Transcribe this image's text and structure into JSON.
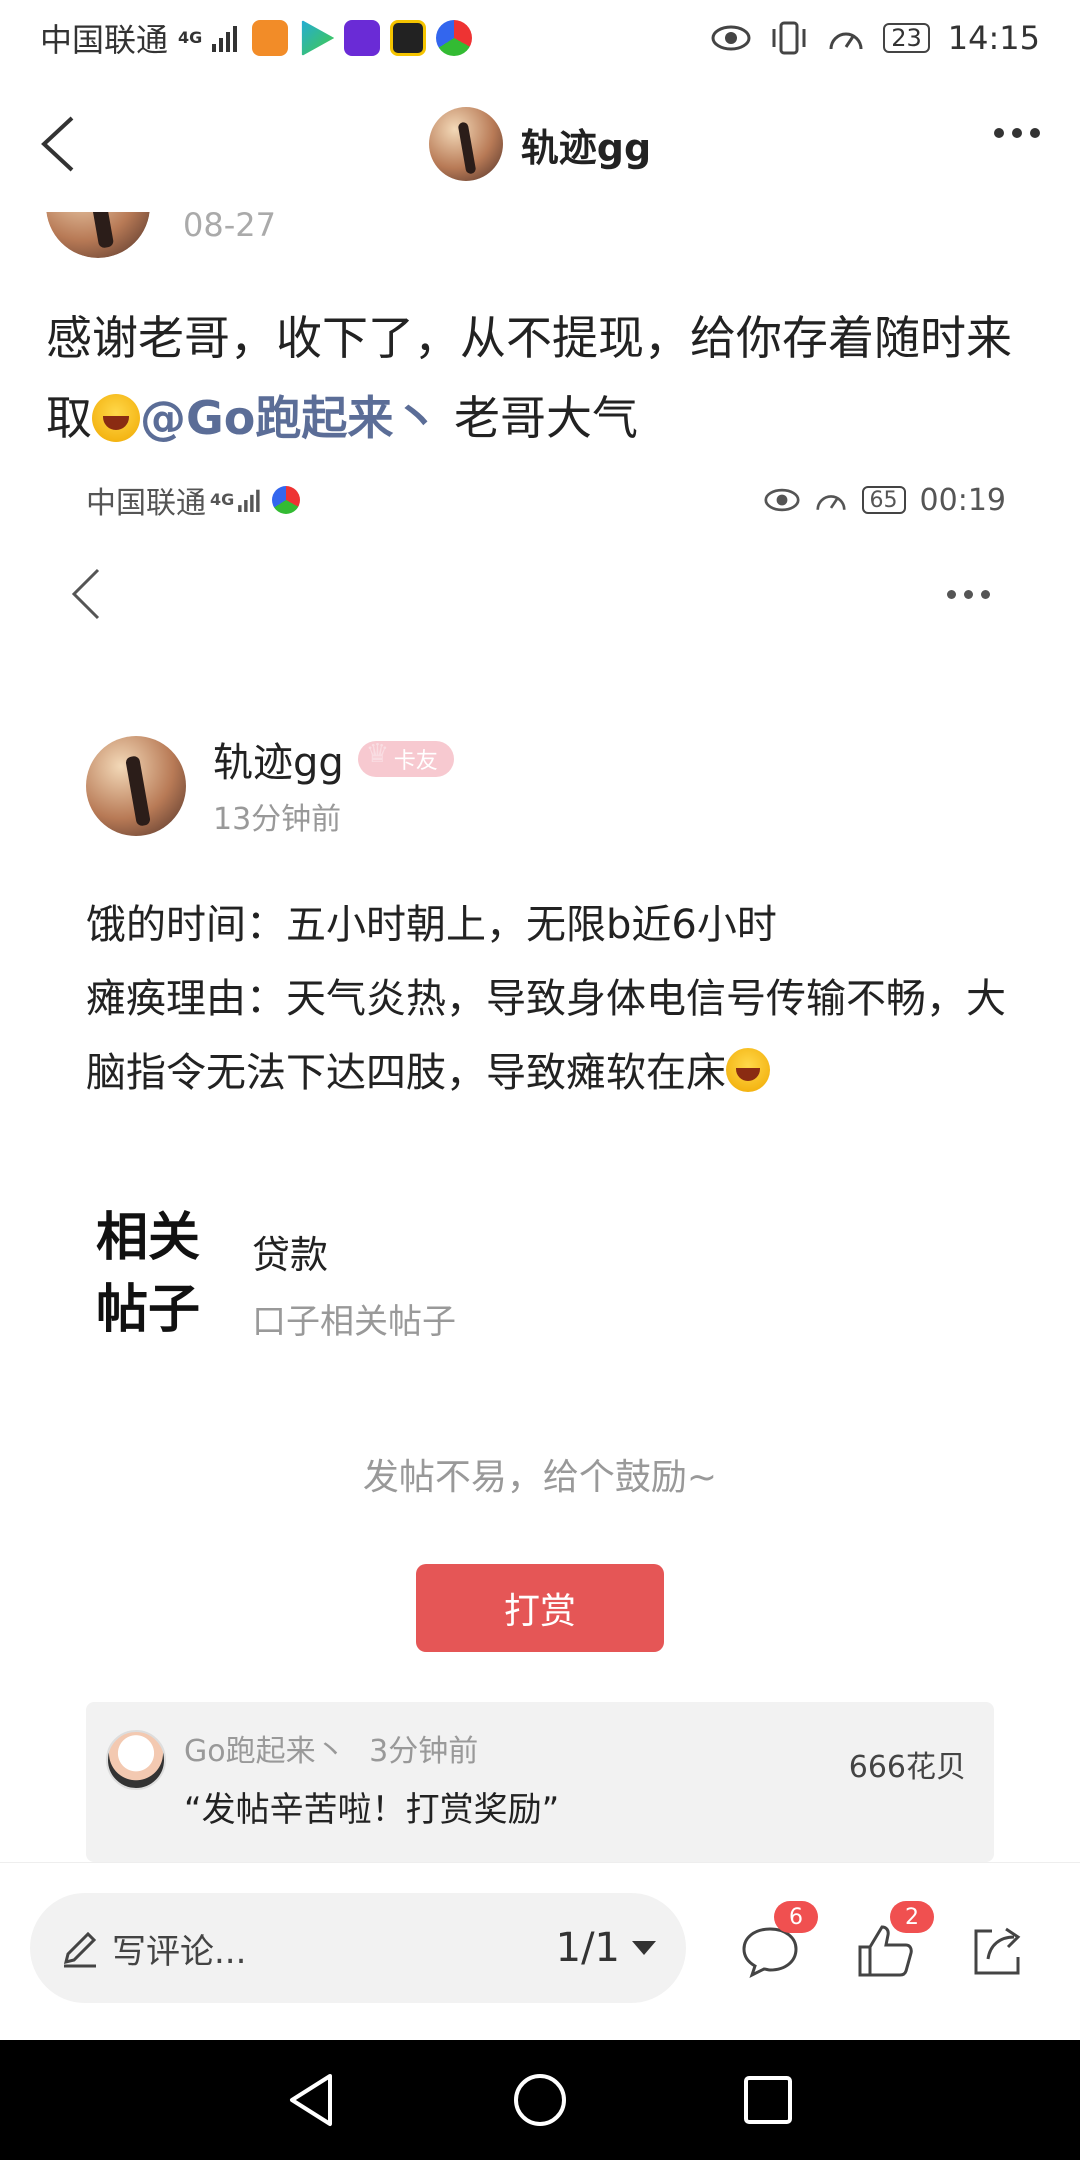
{
  "status_bar": {
    "carrier": "中国联通",
    "network": "4G",
    "battery": "23",
    "time": "14:15"
  },
  "header": {
    "title": "轨迹gg"
  },
  "partial_post": {
    "date": "08-27"
  },
  "post": {
    "text_part1": "感谢老哥，收下了，从不提现，给你存着随时来取",
    "mention": "@Go跑起来丶",
    "text_part2": "老哥大气"
  },
  "screenshot": {
    "status_bar": {
      "carrier": "中国联通",
      "network": "4G",
      "battery": "65",
      "time": "00:19"
    },
    "author": {
      "name": "轨迹gg",
      "badge": "卡友",
      "time": "13分钟前"
    },
    "body": {
      "line1": "饿的时间：五小时朝上，无限b近6小时",
      "line2": "瘫痪理由：天气炎热，导致身体电信号传输不畅，大脑指令无法下达四肢，导致瘫软在床"
    },
    "related": {
      "title": "相关帖子",
      "item1": "贷款",
      "item2": "口子相关帖子"
    },
    "encourage": "发帖不易，给个鼓励~",
    "tip_button": "打赏",
    "tip_record": {
      "user": "Go跑起来丶",
      "time": "3分钟前",
      "message": "“发帖辛苦啦！打赏奖励”",
      "amount": "666花贝"
    }
  },
  "bottom_bar": {
    "comment_placeholder": "写评论...",
    "pager": "1/1",
    "comment_count": "6",
    "like_count": "2"
  },
  "colors": {
    "mention": "#5b6d97",
    "tip_button": "#e55656",
    "badge_count": "#f05050"
  }
}
